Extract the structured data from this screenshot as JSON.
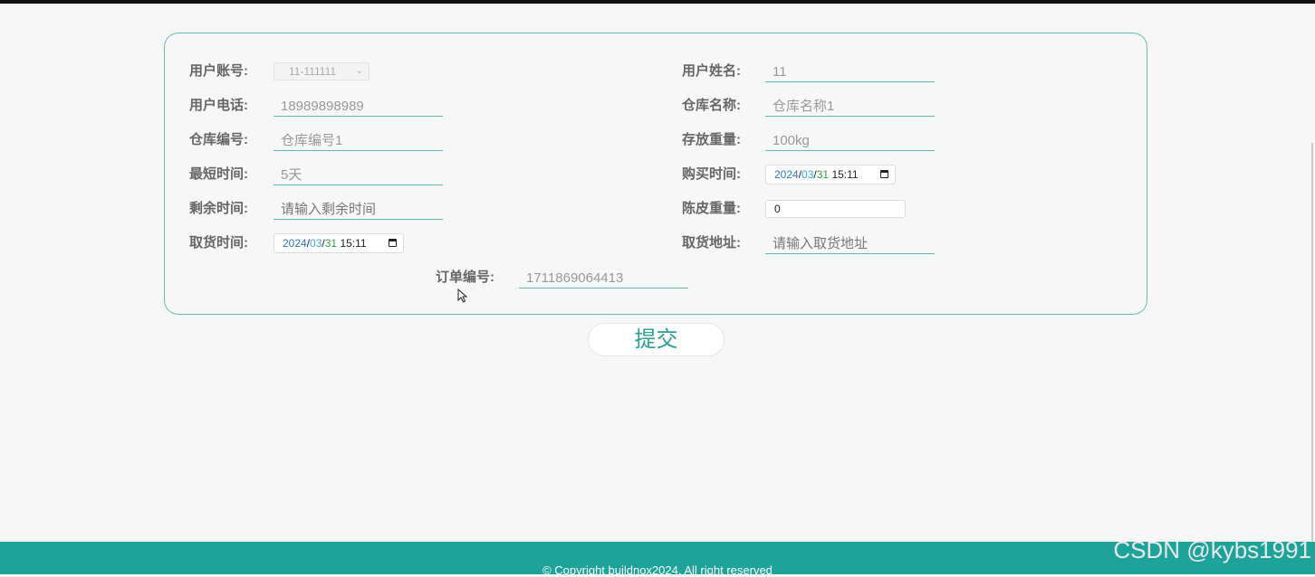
{
  "form": {
    "user_account": {
      "label": "用户账号:",
      "value": "11-111111"
    },
    "user_name": {
      "label": "用户姓名:",
      "value": "11"
    },
    "user_phone": {
      "label": "用户电话:",
      "value": "18989898989"
    },
    "warehouse_name": {
      "label": "仓库名称:",
      "value": "仓库名称1"
    },
    "warehouse_number": {
      "label": "仓库编号:",
      "value": "仓库编号1"
    },
    "stored_weight": {
      "label": "存放重量:",
      "value": "100kg"
    },
    "min_time": {
      "label": "最短时间:",
      "value": "5天"
    },
    "purchase_time": {
      "label": "购买时间:",
      "year": "2024",
      "month": "03",
      "day": "31",
      "time": "15:11"
    },
    "remaining_time": {
      "label": "剩余时间:",
      "placeholder": "请输入剩余时间"
    },
    "tare_weight": {
      "label": "陈皮重量:",
      "value": "0"
    },
    "pickup_time": {
      "label": "取货时间:",
      "year": "2024",
      "month": "03",
      "day": "31",
      "time": "15:11"
    },
    "pickup_address": {
      "label": "取货地址:",
      "placeholder": "请输入取货地址"
    },
    "order_number": {
      "label": "订单编号:",
      "value": "1711869064413"
    }
  },
  "submit_label": "提交",
  "footer_text": "© Copyright buildnox2024. All right reserved",
  "watermark": "CSDN @kybs1991",
  "colors": {
    "accent": "#1da39a",
    "border": "#6bbdb8",
    "label": "#666666",
    "background": "#f7f7f7"
  }
}
